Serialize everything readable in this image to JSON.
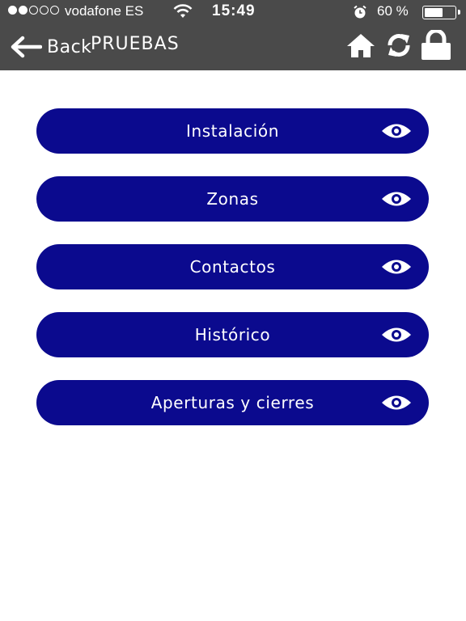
{
  "status": {
    "carrier": "vodafone ES",
    "time": "15:49",
    "battery": "60 %",
    "battery_level": 0.6
  },
  "nav": {
    "back_label": "Back",
    "title": "PRUEBAS"
  },
  "menu": {
    "items": [
      {
        "label": "Instalación"
      },
      {
        "label": "Zonas"
      },
      {
        "label": "Contactos"
      },
      {
        "label": "Histórico"
      },
      {
        "label": "Aperturas y cierres"
      }
    ]
  },
  "colors": {
    "bar_background": "#4a4a4a",
    "button_background": "#0b0a8e",
    "text_light": "#ffffff"
  }
}
